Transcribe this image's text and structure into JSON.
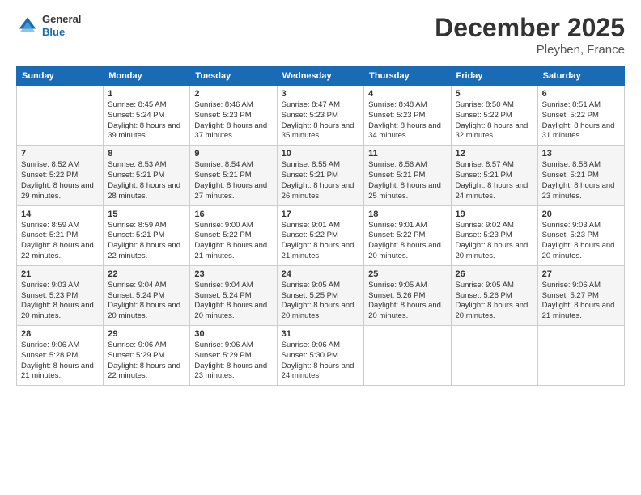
{
  "header": {
    "logo_general": "General",
    "logo_blue": "Blue",
    "month_title": "December 2025",
    "location": "Pleyben, France"
  },
  "days_of_week": [
    "Sunday",
    "Monday",
    "Tuesday",
    "Wednesday",
    "Thursday",
    "Friday",
    "Saturday"
  ],
  "weeks": [
    [
      {
        "day": "",
        "sunrise": "",
        "sunset": "",
        "daylight": ""
      },
      {
        "day": "1",
        "sunrise": "8:45 AM",
        "sunset": "5:24 PM",
        "daylight": "8 hours and 39 minutes."
      },
      {
        "day": "2",
        "sunrise": "8:46 AM",
        "sunset": "5:23 PM",
        "daylight": "8 hours and 37 minutes."
      },
      {
        "day": "3",
        "sunrise": "8:47 AM",
        "sunset": "5:23 PM",
        "daylight": "8 hours and 35 minutes."
      },
      {
        "day": "4",
        "sunrise": "8:48 AM",
        "sunset": "5:23 PM",
        "daylight": "8 hours and 34 minutes."
      },
      {
        "day": "5",
        "sunrise": "8:50 AM",
        "sunset": "5:22 PM",
        "daylight": "8 hours and 32 minutes."
      },
      {
        "day": "6",
        "sunrise": "8:51 AM",
        "sunset": "5:22 PM",
        "daylight": "8 hours and 31 minutes."
      }
    ],
    [
      {
        "day": "7",
        "sunrise": "8:52 AM",
        "sunset": "5:22 PM",
        "daylight": "8 hours and 29 minutes."
      },
      {
        "day": "8",
        "sunrise": "8:53 AM",
        "sunset": "5:21 PM",
        "daylight": "8 hours and 28 minutes."
      },
      {
        "day": "9",
        "sunrise": "8:54 AM",
        "sunset": "5:21 PM",
        "daylight": "8 hours and 27 minutes."
      },
      {
        "day": "10",
        "sunrise": "8:55 AM",
        "sunset": "5:21 PM",
        "daylight": "8 hours and 26 minutes."
      },
      {
        "day": "11",
        "sunrise": "8:56 AM",
        "sunset": "5:21 PM",
        "daylight": "8 hours and 25 minutes."
      },
      {
        "day": "12",
        "sunrise": "8:57 AM",
        "sunset": "5:21 PM",
        "daylight": "8 hours and 24 minutes."
      },
      {
        "day": "13",
        "sunrise": "8:58 AM",
        "sunset": "5:21 PM",
        "daylight": "8 hours and 23 minutes."
      }
    ],
    [
      {
        "day": "14",
        "sunrise": "8:59 AM",
        "sunset": "5:21 PM",
        "daylight": "8 hours and 22 minutes."
      },
      {
        "day": "15",
        "sunrise": "8:59 AM",
        "sunset": "5:21 PM",
        "daylight": "8 hours and 22 minutes."
      },
      {
        "day": "16",
        "sunrise": "9:00 AM",
        "sunset": "5:22 PM",
        "daylight": "8 hours and 21 minutes."
      },
      {
        "day": "17",
        "sunrise": "9:01 AM",
        "sunset": "5:22 PM",
        "daylight": "8 hours and 21 minutes."
      },
      {
        "day": "18",
        "sunrise": "9:01 AM",
        "sunset": "5:22 PM",
        "daylight": "8 hours and 20 minutes."
      },
      {
        "day": "19",
        "sunrise": "9:02 AM",
        "sunset": "5:23 PM",
        "daylight": "8 hours and 20 minutes."
      },
      {
        "day": "20",
        "sunrise": "9:03 AM",
        "sunset": "5:23 PM",
        "daylight": "8 hours and 20 minutes."
      }
    ],
    [
      {
        "day": "21",
        "sunrise": "9:03 AM",
        "sunset": "5:23 PM",
        "daylight": "8 hours and 20 minutes."
      },
      {
        "day": "22",
        "sunrise": "9:04 AM",
        "sunset": "5:24 PM",
        "daylight": "8 hours and 20 minutes."
      },
      {
        "day": "23",
        "sunrise": "9:04 AM",
        "sunset": "5:24 PM",
        "daylight": "8 hours and 20 minutes."
      },
      {
        "day": "24",
        "sunrise": "9:05 AM",
        "sunset": "5:25 PM",
        "daylight": "8 hours and 20 minutes."
      },
      {
        "day": "25",
        "sunrise": "9:05 AM",
        "sunset": "5:26 PM",
        "daylight": "8 hours and 20 minutes."
      },
      {
        "day": "26",
        "sunrise": "9:05 AM",
        "sunset": "5:26 PM",
        "daylight": "8 hours and 20 minutes."
      },
      {
        "day": "27",
        "sunrise": "9:06 AM",
        "sunset": "5:27 PM",
        "daylight": "8 hours and 21 minutes."
      }
    ],
    [
      {
        "day": "28",
        "sunrise": "9:06 AM",
        "sunset": "5:28 PM",
        "daylight": "8 hours and 21 minutes."
      },
      {
        "day": "29",
        "sunrise": "9:06 AM",
        "sunset": "5:29 PM",
        "daylight": "8 hours and 22 minutes."
      },
      {
        "day": "30",
        "sunrise": "9:06 AM",
        "sunset": "5:29 PM",
        "daylight": "8 hours and 23 minutes."
      },
      {
        "day": "31",
        "sunrise": "9:06 AM",
        "sunset": "5:30 PM",
        "daylight": "8 hours and 24 minutes."
      },
      {
        "day": "",
        "sunrise": "",
        "sunset": "",
        "daylight": ""
      },
      {
        "day": "",
        "sunrise": "",
        "sunset": "",
        "daylight": ""
      },
      {
        "day": "",
        "sunrise": "",
        "sunset": "",
        "daylight": ""
      }
    ]
  ]
}
